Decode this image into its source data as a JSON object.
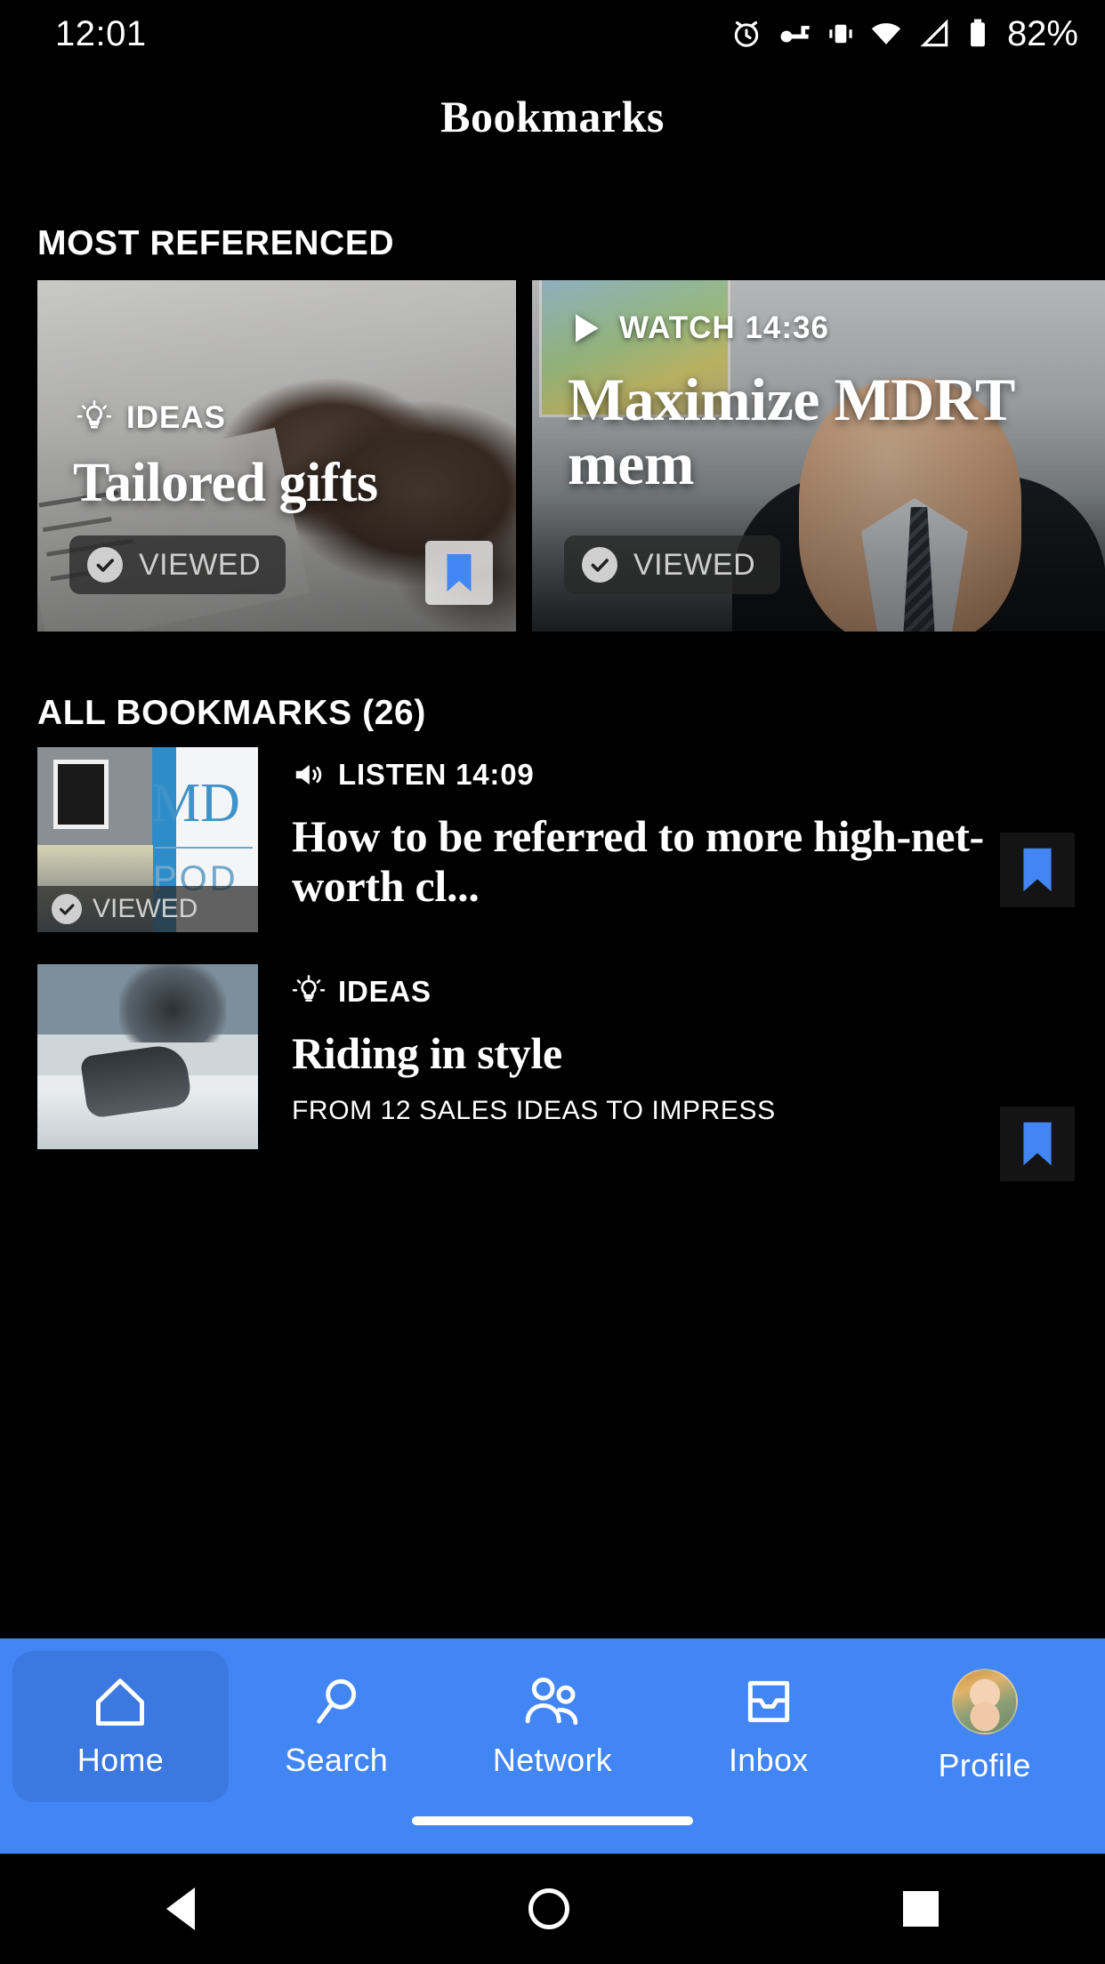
{
  "status_bar": {
    "time": "12:01",
    "battery": "82%",
    "icons": [
      "alarm-icon",
      "vpn-key-icon",
      "vibrate-icon",
      "wifi-icon",
      "signal-icon",
      "battery-icon"
    ]
  },
  "header": {
    "title": "Bookmarks"
  },
  "sections": {
    "most_referenced": {
      "label": "MOST REFERENCED"
    },
    "all_bookmarks": {
      "label": "ALL BOOKMARKS (26)"
    }
  },
  "featured": [
    {
      "kicker": "IDEAS",
      "kicker_icon": "lightbulb-icon",
      "title": "Tailored gifts",
      "viewed_label": "VIEWED",
      "bookmarked": true,
      "bookmark_color": "#4285F4"
    },
    {
      "kicker": "WATCH 14:36",
      "kicker_icon": "play-icon",
      "title": "Maximize MDRT mem",
      "viewed_label": "VIEWED",
      "bookmarked": true,
      "bookmark_color": "#4285F4"
    }
  ],
  "list": [
    {
      "kicker": "LISTEN 14:09",
      "kicker_icon": "speaker-icon",
      "title": "How to be referred to more high-net-worth cl...",
      "subtitle": "",
      "viewed_label": "VIEWED",
      "bookmarked": true
    },
    {
      "kicker": "IDEAS",
      "kicker_icon": "lightbulb-icon",
      "title": "Riding in style",
      "subtitle": "FROM 12 SALES IDEAS TO IMPRESS",
      "viewed_label": "",
      "bookmarked": true
    }
  ],
  "bottom_nav": {
    "background": "#4285F4",
    "active_background": "#3B78E0",
    "items": [
      {
        "label": "Home",
        "icon": "home-icon",
        "active": true
      },
      {
        "label": "Search",
        "icon": "search-icon",
        "active": false
      },
      {
        "label": "Network",
        "icon": "people-icon",
        "active": false
      },
      {
        "label": "Inbox",
        "icon": "inbox-icon",
        "active": false
      },
      {
        "label": "Profile",
        "icon": "avatar-icon",
        "active": false
      }
    ]
  },
  "system_nav": {
    "back": "back-button",
    "home": "home-button",
    "recents": "recents-button"
  }
}
